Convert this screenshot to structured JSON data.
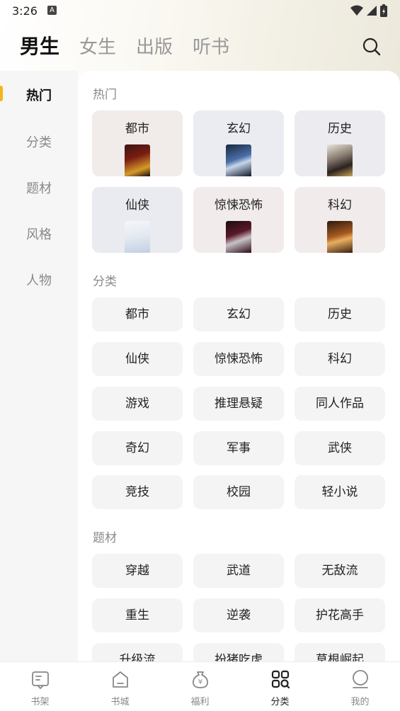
{
  "status": {
    "time": "3:26",
    "notification_letter": "A"
  },
  "top_tabs": [
    {
      "label": "男生",
      "active": true
    },
    {
      "label": "女生",
      "active": false
    },
    {
      "label": "出版",
      "active": false
    },
    {
      "label": "听书",
      "active": false
    }
  ],
  "sidebar": {
    "items": [
      {
        "label": "热门",
        "active": true
      },
      {
        "label": "分类",
        "active": false
      },
      {
        "label": "题材",
        "active": false
      },
      {
        "label": "风格",
        "active": false
      },
      {
        "label": "人物",
        "active": false
      }
    ]
  },
  "sections": {
    "hot": {
      "title": "热门",
      "cards": [
        {
          "label": "都市",
          "bg": "#f1ebea"
        },
        {
          "label": "玄幻",
          "bg": "#ebecf1"
        },
        {
          "label": "历史",
          "bg": "#ecebef"
        },
        {
          "label": "仙侠",
          "bg": "#eaebf0"
        },
        {
          "label": "惊悚恐怖",
          "bg": "#f1ebeb"
        },
        {
          "label": "科幻",
          "bg": "#f1eceb"
        }
      ]
    },
    "category": {
      "title": "分类",
      "items": [
        "都市",
        "玄幻",
        "历史",
        "仙侠",
        "惊悚恐怖",
        "科幻",
        "游戏",
        "推理悬疑",
        "同人作品",
        "奇幻",
        "军事",
        "武侠",
        "竞技",
        "校园",
        "轻小说"
      ]
    },
    "theme": {
      "title": "题材",
      "items": [
        "穿越",
        "武道",
        "无敌流",
        "重生",
        "逆袭",
        "护花高手",
        "升级流",
        "扮猪吃虎",
        "草根崛起"
      ]
    }
  },
  "bottom_nav": [
    {
      "label": "书架",
      "icon": "bookshelf-icon",
      "active": false
    },
    {
      "label": "书城",
      "icon": "bookstore-icon",
      "active": false
    },
    {
      "label": "福利",
      "icon": "welfare-icon",
      "active": false
    },
    {
      "label": "分类",
      "icon": "category-icon",
      "active": true
    },
    {
      "label": "我的",
      "icon": "profile-icon",
      "active": false
    }
  ],
  "colors": {
    "accent": "#f5b51c",
    "text_primary": "#222222",
    "text_secondary": "#8a8a8a",
    "pill_bg": "#f4f4f4"
  }
}
